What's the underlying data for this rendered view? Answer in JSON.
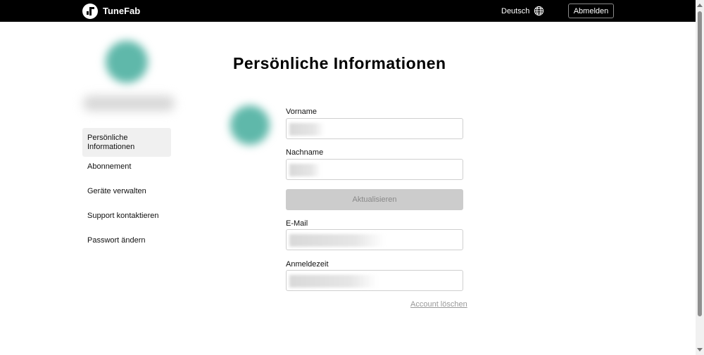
{
  "header": {
    "brand": "TuneFab",
    "language": "Deutsch",
    "logout_label": "Abmelden"
  },
  "sidebar": {
    "items": [
      {
        "label": "Persönliche Informationen",
        "active": true
      },
      {
        "label": "Abonnement",
        "active": false
      },
      {
        "label": "Geräte verwalten",
        "active": false
      },
      {
        "label": "Support kontaktieren",
        "active": false
      },
      {
        "label": "Passwort ändern",
        "active": false
      }
    ]
  },
  "main": {
    "title": "Persönliche Informationen",
    "fields": {
      "first_name_label": "Vorname",
      "last_name_label": "Nachname",
      "email_label": "E-Mail",
      "login_time_label": "Anmeldezeit"
    },
    "update_label": "Aktualisieren",
    "delete_account_label": "Account löschen"
  },
  "colors": {
    "topbar": "#000000",
    "avatar": "#5fb8aa",
    "disabled_button": "#cccccc",
    "active_nav": "#f0f0f0"
  },
  "icons": {
    "brand_logo": "tunefab-logo-icon",
    "language": "globe-icon"
  }
}
